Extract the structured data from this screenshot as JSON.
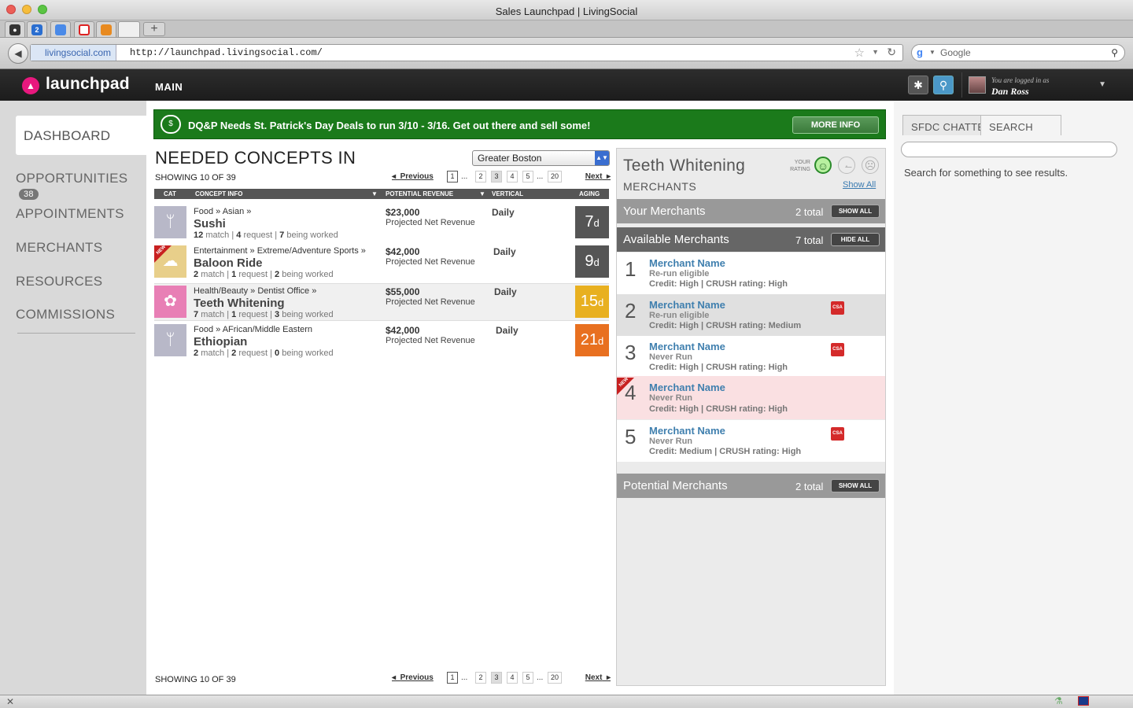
{
  "browser": {
    "window_title": "Sales Launchpad | LivingSocial",
    "url_domain": "livingsocial.com",
    "url": "http://launchpad.livingsocial.com/",
    "search_placeholder": "Google",
    "tab_badge": "2"
  },
  "header": {
    "logo": "launchpad",
    "nav_main": "MAIN",
    "logged_in_label": "You are logged in as",
    "user_name": "Dan Ross"
  },
  "sidebar": {
    "items": [
      {
        "label": "DASHBOARD"
      },
      {
        "label": "OPPORTUNITIES",
        "badge": "38"
      },
      {
        "label": "APPOINTMENTS"
      },
      {
        "label": "MERCHANTS"
      },
      {
        "label": "RESOURCES"
      },
      {
        "label": "COMMISSIONS"
      }
    ]
  },
  "banner": {
    "text": "DQ&P Needs St. Patrick's Day Deals to run 3/10 - 3/16. Get out there and sell some!",
    "button": "MORE INFO",
    "color": "#1b7a1b"
  },
  "concepts": {
    "title": "NEEDED CONCEPTS IN",
    "region": "Greater Boston",
    "showing": "SHOWING 10 OF 39",
    "pager": {
      "prev": "Previous",
      "next": "Next",
      "pages": [
        "1",
        "2",
        "3",
        "4",
        "5",
        "20"
      ],
      "dots": "..."
    },
    "columns": [
      "CAT",
      "CONCEPT INFO",
      "POTENTIAL REVENUE",
      "VERTICAL",
      "AGING"
    ],
    "rows": [
      {
        "category": "Food » Asian »",
        "name": "Sushi",
        "match": "12",
        "request": "4",
        "worked": "7",
        "revenue": "$23,000",
        "revenue_sub": "Projected Net Revenue",
        "vertical": "Daily",
        "aging": "7",
        "aging_unit": "d",
        "aging_color": "#555555",
        "icon": "fork-knife-icon",
        "is_new": false
      },
      {
        "category": "Entertainment » Extreme/Adventure Sports »",
        "name": "Baloon Ride",
        "match": "2",
        "request": "1",
        "worked": "2",
        "revenue": "$42,000",
        "revenue_sub": "Projected Net Revenue",
        "vertical": "Daily",
        "aging": "9",
        "aging_unit": "d",
        "aging_color": "#555555",
        "icon": "balloon-icon",
        "is_new": true
      },
      {
        "category": "Health/Beauty » Dentist Office »",
        "name": "Teeth Whitening",
        "match": "7",
        "request": "1",
        "worked": "3",
        "revenue": "$55,000",
        "revenue_sub": "Projected Net Revenue",
        "vertical": "Daily",
        "aging": "15",
        "aging_unit": "d",
        "aging_color": "#e8b020",
        "icon": "flower-icon",
        "is_new": false
      },
      {
        "category": "Food » AFrican/Middle Eastern",
        "name": "Ethiopian",
        "match": "2",
        "request": "2",
        "worked": "0",
        "revenue": "$42,000",
        "revenue_sub": "Projected Net Revenue",
        "vertical": "Daily",
        "aging": "21",
        "aging_unit": "d",
        "aging_color": "#e87020",
        "icon": "fork-knife-icon",
        "is_new": false
      }
    ],
    "labels": {
      "match": "match",
      "request": "request",
      "worked": "being worked",
      "new": "NEW"
    }
  },
  "merchants_panel": {
    "title": "Teeth Whitening",
    "subtitle": "MERCHANTS",
    "rating_label": "YOUR RATING",
    "show_all": "Show All",
    "your_merchants": {
      "label": "Your Merchants",
      "count": "2 total",
      "button": "SHOW ALL"
    },
    "available": {
      "label": "Available Merchants",
      "count": "7 total",
      "button": "HIDE ALL"
    },
    "potential": {
      "label": "Potential Merchants",
      "count": "2 total",
      "button": "SHOW ALL"
    },
    "merchants": [
      {
        "num": "1",
        "name": "Merchant Name",
        "status": "Re-run eligible",
        "credit": "Credit: High | CRUSH rating: High",
        "csa": false,
        "style": "white"
      },
      {
        "num": "2",
        "name": "Merchant Name",
        "status": "Re-run eligible",
        "credit": "Credit: High | CRUSH rating: Medium",
        "csa": true,
        "style": "gray"
      },
      {
        "num": "3",
        "name": "Merchant Name",
        "status": "Never Run",
        "credit": "Credit: High | CRUSH rating: High",
        "csa": true,
        "style": "white"
      },
      {
        "num": "4",
        "name": "Merchant Name",
        "status": "Never Run",
        "credit": "Credit: High | CRUSH rating: High",
        "csa": false,
        "style": "pink",
        "is_new": true
      },
      {
        "num": "5",
        "name": "Merchant Name",
        "status": "Never Run",
        "credit": "Credit: Medium | CRUSH rating: High",
        "csa": true,
        "style": "white"
      }
    ],
    "csa_label": "CSA"
  },
  "right_panel": {
    "tabs": [
      "SFDC CHATTER",
      "SEARCH"
    ],
    "hint": "Search for something to see results."
  }
}
